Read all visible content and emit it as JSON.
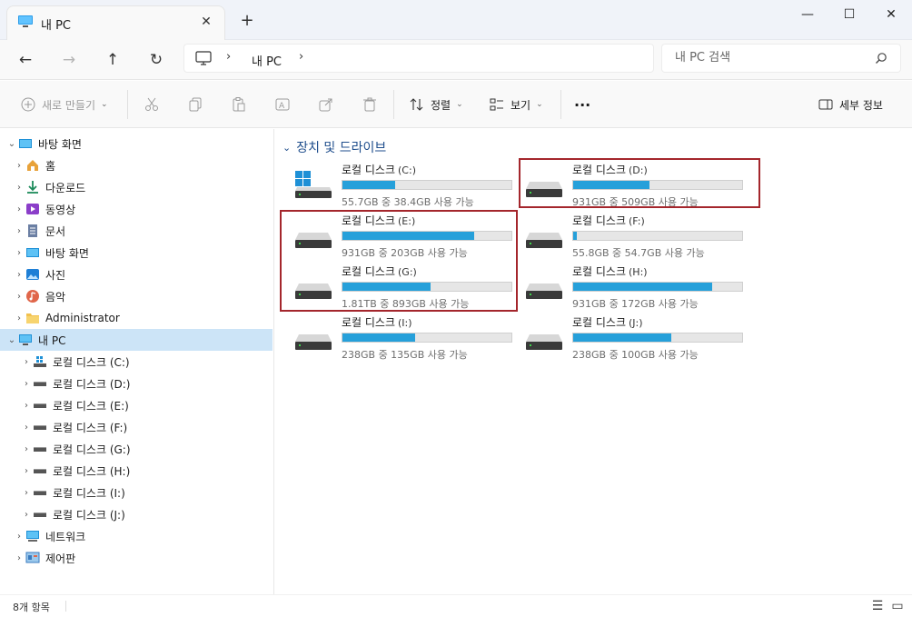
{
  "window": {
    "tab_title": "내 PC",
    "new_tab_glyph": "+",
    "close_tab_glyph": "✕",
    "minimize_glyph": "—",
    "maximize_glyph": "☐",
    "close_glyph": "✕"
  },
  "nav": {
    "back_glyph": "←",
    "forward_glyph": "→",
    "up_glyph": "↑",
    "refresh_glyph": "↻"
  },
  "address": {
    "separator": "›",
    "location": "내 PC",
    "trailing_separator": "›"
  },
  "search": {
    "placeholder": "내 PC 검색"
  },
  "toolbar": {
    "new_label": "새로 만들기",
    "sort_label": "정렬",
    "view_label": "보기",
    "more_label": "···",
    "details_label": "세부 정보",
    "chevron": "⌄"
  },
  "sidebar": {
    "items": [
      {
        "label": "바탕 화면",
        "icon": "desktop-icon"
      },
      {
        "label": "홈",
        "icon": "home-icon"
      },
      {
        "label": "다운로드",
        "icon": "download-icon"
      },
      {
        "label": "동영상",
        "icon": "video-icon"
      },
      {
        "label": "문서",
        "icon": "document-icon"
      },
      {
        "label": "바탕 화면",
        "icon": "desktop-icon"
      },
      {
        "label": "사진",
        "icon": "pictures-icon"
      },
      {
        "label": "음악",
        "icon": "music-icon"
      },
      {
        "label": "Administrator",
        "icon": "folder-icon"
      },
      {
        "label": "내 PC",
        "icon": "pc-icon"
      },
      {
        "label": "로컬 디스크 (C:)",
        "icon": "windows-drive-icon"
      },
      {
        "label": "로컬 디스크 (D:)",
        "icon": "drive-icon"
      },
      {
        "label": "로컬 디스크 (E:)",
        "icon": "drive-icon"
      },
      {
        "label": "로컬 디스크 (F:)",
        "icon": "drive-icon"
      },
      {
        "label": "로컬 디스크 (G:)",
        "icon": "drive-icon"
      },
      {
        "label": "로컬 디스크 (H:)",
        "icon": "drive-icon"
      },
      {
        "label": "로컬 디스크 (I:)",
        "icon": "drive-icon"
      },
      {
        "label": "로컬 디스크 (J:)",
        "icon": "drive-icon"
      },
      {
        "label": "네트워크",
        "icon": "network-icon"
      },
      {
        "label": "제어판",
        "icon": "control-panel-icon"
      }
    ]
  },
  "content": {
    "group_title": "장치 및 드라이브",
    "group_chevron": "⌄",
    "drives": [
      {
        "name": "로컬 디스크",
        "letter": "(C:)",
        "free_text": "55.7GB 중 38.4GB 사용 가능",
        "used_fraction": 0.31,
        "icon": "windows-drive-icon"
      },
      {
        "name": "로컬 디스크",
        "letter": "(D:)",
        "free_text": "931GB 중 509GB 사용 가능",
        "used_fraction": 0.45,
        "icon": "drive-icon"
      },
      {
        "name": "로컬 디스크",
        "letter": "(E:)",
        "free_text": "931GB 중 203GB 사용 가능",
        "used_fraction": 0.78,
        "icon": "drive-icon"
      },
      {
        "name": "로컬 디스크",
        "letter": "(F:)",
        "free_text": "55.8GB 중 54.7GB 사용 가능",
        "used_fraction": 0.02,
        "icon": "drive-icon"
      },
      {
        "name": "로컬 디스크",
        "letter": "(G:)",
        "free_text": "1.81TB 중 893GB 사용 가능",
        "used_fraction": 0.52,
        "icon": "drive-icon"
      },
      {
        "name": "로컬 디스크",
        "letter": "(H:)",
        "free_text": "931GB 중 172GB 사용 가능",
        "used_fraction": 0.82,
        "icon": "drive-icon"
      },
      {
        "name": "로컬 디스크",
        "letter": "(I:)",
        "free_text": "238GB 중 135GB 사용 가능",
        "used_fraction": 0.43,
        "icon": "drive-icon"
      },
      {
        "name": "로컬 디스크",
        "letter": "(J:)",
        "free_text": "238GB 중 100GB 사용 가능",
        "used_fraction": 0.58,
        "icon": "drive-icon"
      }
    ]
  },
  "status": {
    "item_count": "8개 항목"
  },
  "colors": {
    "accent": "#26a0da",
    "selection": "#cce4f7",
    "highlight": "#a4262c"
  }
}
